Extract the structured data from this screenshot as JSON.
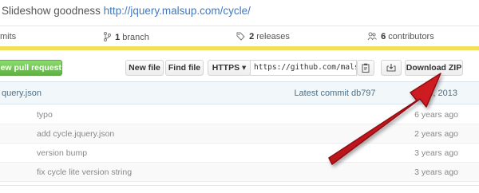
{
  "repo": {
    "description": "Slideshow goodness",
    "homepage": "http://jquery.malsup.com/cycle/"
  },
  "stats": {
    "commits_label": "mits",
    "branches_count": "1",
    "branches_label": "branch",
    "releases_count": "2",
    "releases_label": "releases",
    "contributors_count": "6",
    "contributors_label": "contributors"
  },
  "toolbar": {
    "new_pull_request": "New pull request",
    "new_file": "New file",
    "find_file": "Find file",
    "protocol": "HTTPS ▾",
    "clone_url": "https://github.com/malsu",
    "download_zip": "Download ZIP"
  },
  "commit_bar": {
    "left_text": "query.json",
    "latest_label": "Latest commit db797",
    "date_text": "v 15, 2013"
  },
  "files": [
    {
      "message": "typo",
      "age": "6 years ago"
    },
    {
      "message": "add cycle.jquery.json",
      "age": "2 years ago"
    },
    {
      "message": "version bump",
      "age": "3 years ago"
    },
    {
      "message": "fix cycle lite version string",
      "age": "3 years ago"
    }
  ],
  "colors": {
    "link": "#4078c0",
    "language_bar": "#f1e05a",
    "pull_request_green": "#60b044",
    "arrow_red": "#c0161b"
  }
}
